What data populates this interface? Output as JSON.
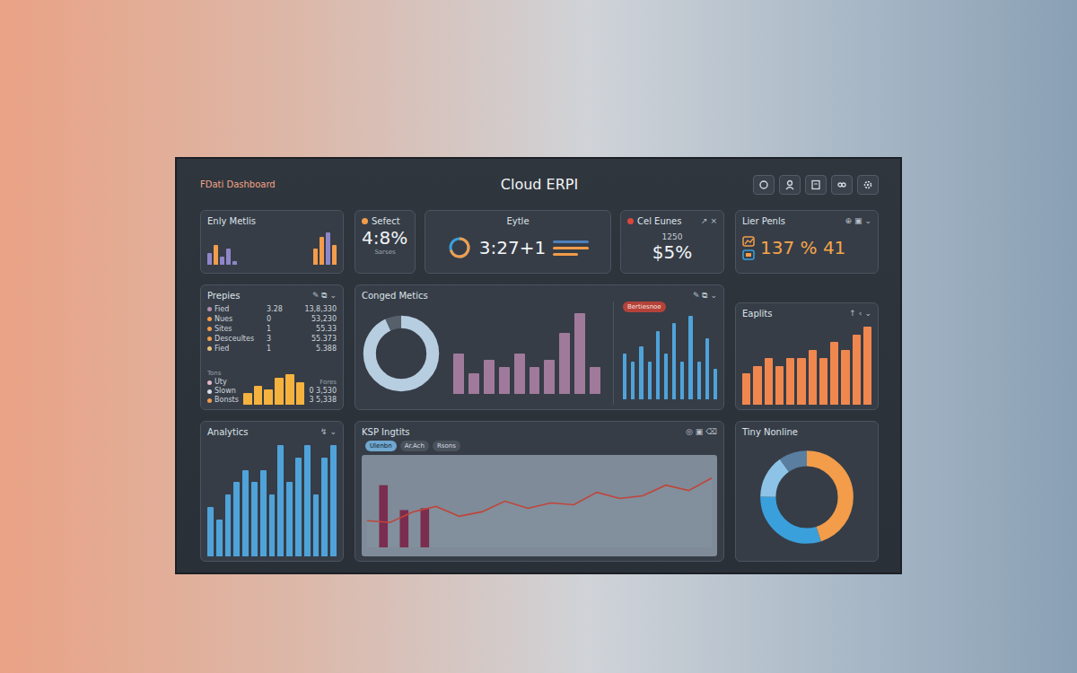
{
  "header": {
    "brand": "FDati Dashboard",
    "title": "Cloud ERPI"
  },
  "metrics_card": {
    "title": "Enly Metlis",
    "groups": [
      [
        {
          "value": 3,
          "color": "#8f86c9"
        },
        {
          "value": 5,
          "color": "#f39c4a"
        },
        {
          "value": 2,
          "color": "#8f86c9"
        },
        {
          "value": 4,
          "color": "#8f86c9"
        },
        {
          "value": 1,
          "color": "#8f86c9"
        }
      ],
      [
        {
          "value": 4,
          "color": "#f39c4a"
        },
        {
          "value": 7,
          "color": "#f39c4a"
        },
        {
          "value": 8,
          "color": "#8f86c9"
        },
        {
          "value": 5,
          "color": "#f39c4a"
        }
      ]
    ]
  },
  "select_card": {
    "title": "Sefect",
    "value": "4:8%",
    "caption": "Sarses"
  },
  "cycle_card": {
    "title": "Eytle",
    "value": "3:27+1",
    "lines": [
      {
        "level": 1,
        "color": "#4f7fb8"
      },
      {
        "level": 1,
        "color": "#f39c4a"
      },
      {
        "level": 0.7,
        "color": "#f39c4a"
      }
    ]
  },
  "sales_card": {
    "title": "Cel Eunes",
    "marks": [
      "↗",
      "×"
    ],
    "small": "1250",
    "value": "$5%"
  },
  "profit_card": {
    "title": "Lier Penls",
    "marks": [
      "⊕",
      "▣",
      "⌄"
    ],
    "value": "137 % 41"
  },
  "list_card": {
    "title": "Prepies",
    "marks": [
      "✎",
      "⧉",
      "⌄"
    ],
    "rows": [
      {
        "label": "Fied",
        "color": "#b48ead",
        "value": "3.28",
        "total": "13,8,330"
      },
      {
        "label": "Nues",
        "color": "#f39c4a",
        "value": "0",
        "total": "53,230"
      },
      {
        "label": "Sites",
        "color": "#f39c4a",
        "value": "1",
        "total": "55.33"
      },
      {
        "label": "Desceultes",
        "color": "#f39c4a",
        "value": "3",
        "total": "55.373"
      },
      {
        "label": "Fied",
        "color": "#e8c07a",
        "value": "1",
        "total": "5.388"
      }
    ],
    "legend_title": "Tons",
    "legend": [
      {
        "label": "Uty",
        "color": "#e3b7c8"
      },
      {
        "label": "Slown",
        "color": "#d9dde2"
      },
      {
        "label": "Bonsts",
        "color": "#f39c4a"
      }
    ],
    "bars": [
      3,
      5,
      4,
      7,
      8,
      6
    ],
    "totals_title": "Fores",
    "totals": [
      "0 3,530",
      "3 5,338"
    ]
  },
  "combined_card": {
    "title": "Conged Metics",
    "marks": [
      "✎",
      "⧉",
      "⌄"
    ],
    "donut": [
      {
        "value": 93,
        "color": "#b7cde0"
      },
      {
        "value": 7,
        "color": "#56606b"
      }
    ],
    "pink_bars": [
      6,
      3,
      5,
      4,
      6,
      4,
      5,
      9,
      12,
      4
    ],
    "blue_legend": "Bertiesnoe",
    "blue_bars": [
      6,
      5,
      7,
      5,
      9,
      6,
      10,
      5,
      11,
      5,
      8,
      4
    ]
  },
  "eaplits_card": {
    "title": "Eaplits",
    "marks": [
      "↑",
      "‹",
      "⌄"
    ],
    "values": [
      4,
      5,
      6,
      5,
      6,
      6,
      7,
      6,
      8,
      7,
      9,
      10
    ]
  },
  "analytics_card": {
    "title": "Analytics",
    "marks": [
      "↯",
      "⌄"
    ],
    "values": [
      4,
      3,
      5,
      6,
      7,
      6,
      7,
      5,
      9,
      6,
      8,
      9,
      5,
      8,
      9
    ]
  },
  "insights_card": {
    "title": "KSP Ingtits",
    "marks": [
      "◎",
      "▣",
      "⌫"
    ],
    "pills": [
      {
        "label": "Ulenbn",
        "selected": true
      },
      {
        "label": "Ar.Ach",
        "selected": false
      },
      {
        "label": "Rsons",
        "selected": false
      }
    ],
    "line": [
      30,
      28,
      40,
      46,
      35,
      40,
      52,
      44,
      50,
      48,
      62,
      55,
      58,
      70,
      64,
      78
    ],
    "bars": [
      70,
      42,
      44
    ]
  },
  "donut_card": {
    "title": "Tiny Nonline",
    "segments": [
      {
        "value": 45,
        "color": "#f39c4a"
      },
      {
        "value": 30,
        "color": "#3aa0dc"
      },
      {
        "value": 15,
        "color": "#8cc3e6"
      },
      {
        "value": 10,
        "color": "#5a7ea0"
      }
    ]
  }
}
